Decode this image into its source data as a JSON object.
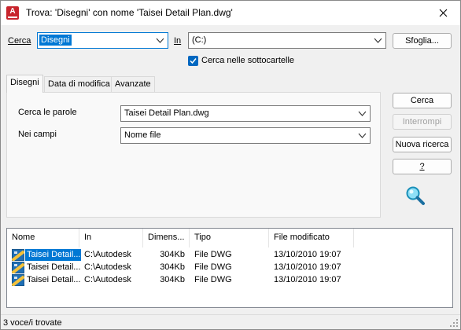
{
  "window": {
    "title": "Trova: 'Disegni' con nome 'Taisei Detail Plan.dwg'"
  },
  "search": {
    "cerca_label_prefix": "",
    "cerca_label": "Cerca",
    "cerca_value": "Disegni",
    "in_label": "In",
    "in_value": "(C:)",
    "browse_label": "Sfoglia...",
    "subfolders_label": "Cerca nelle sottocartelle",
    "subfolders_checked": true
  },
  "tabs": [
    {
      "label": "Disegni",
      "active": true
    },
    {
      "label": "Data di modifica",
      "active": false
    },
    {
      "label": "Avanzate",
      "active": false
    }
  ],
  "panel": {
    "words_label": "Cerca le parole",
    "words_value": "Taisei Detail Plan.dwg",
    "fields_label": "Nei campi",
    "fields_value": "Nome file"
  },
  "actions": {
    "find": "Cerca",
    "stop": "Interrompi",
    "new_search": "Nuova ricerca",
    "help": "?"
  },
  "results": {
    "columns": [
      "Nome",
      "In",
      "Dimens...",
      "Tipo",
      "File modificato"
    ],
    "rows": [
      {
        "name": "Taisei Detail...",
        "in": "C:\\Autodesk",
        "size": "304Kb",
        "type": "File DWG",
        "modified": "13/10/2010 19:07",
        "selected": true
      },
      {
        "name": "Taisei Detail...",
        "in": "C:\\Autodesk",
        "size": "304Kb",
        "type": "File DWG",
        "modified": "13/10/2010 19:07",
        "selected": false
      },
      {
        "name": "Taisei Detail...",
        "in": "C:\\Autodesk",
        "size": "304Kb",
        "type": "File DWG",
        "modified": "13/10/2010 19:07",
        "selected": false
      }
    ]
  },
  "status": {
    "text": "3 voce/i trovate"
  },
  "icons": {
    "app": "autocad-app-icon",
    "close": "close-icon",
    "dropdown": "chevron-down-icon",
    "check": "check-icon",
    "file": "dwg-file-icon",
    "search": "magnifier-icon"
  },
  "colors": {
    "accent": "#0078d4",
    "app_icon": "#c8242c"
  }
}
